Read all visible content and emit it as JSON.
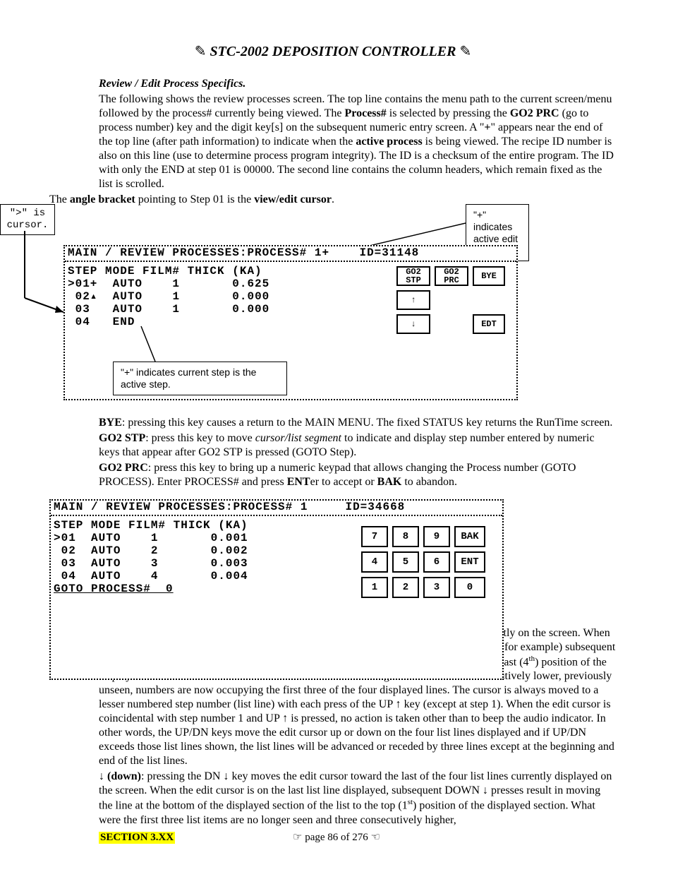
{
  "header": {
    "title": "STC-2002  DEPOSITION CONTROLLER"
  },
  "section_title": "Review / Edit Process Specifics.",
  "intro": {
    "p1a": "The following shows the review processes screen. The top line contains the menu path to the current screen/menu followed by the process# currently being viewed. The ",
    "p1b": "Process#",
    "p1c": " is selected by pressing the ",
    "p1d": "GO2 PRC",
    "p1e": " (go to process number) key and the digit key[s] on  the subsequent numeric entry screen. A \"",
    "p1f": "+",
    "p1g": "\" appears near the end of the top line (after path information) to indicate when the ",
    "p1h": "active process",
    "p1i": " is being viewed. The recipe ID number is also on this line (use to determine process program integrity). The ID is a checksum of the entire program. The ID with only the END at step 01 is 00000. The second line contains the column headers, which remain fixed as the list is scrolled.",
    "p2a": "The ",
    "p2b": "angle bracket",
    "p2c": " pointing to Step 01 is the ",
    "p2d": "view/edit cursor",
    "p2e": "."
  },
  "callouts": {
    "cursor_note_a": "\">\" is",
    "cursor_note_b": "cursor.",
    "plus_note": "\"+\" indicates active edit process.",
    "step_plus_note": "\"+\" indicates current step is the active step."
  },
  "lcd1": {
    "top": "MAIN / REVIEW PROCESSES:PROCESS# 1+    ID=31148",
    "hdr": "STEP MODE FILM# THICK (KA)",
    "rows": [
      ">01+  AUTO    1       0.625",
      " 02▴  AUTO    1       0.000",
      " 03   AUTO    1       0.000",
      " 04   END"
    ],
    "keys": {
      "r1c1": "GO2\nSTP",
      "r1c2": "GO2\nPRC",
      "r1c3": "BYE",
      "r2c1": "↑",
      "r2c2": "",
      "r2c3": "",
      "r3c1": "↓",
      "r3c2": "",
      "r3c3": "EDT"
    }
  },
  "mid_text": {
    "bye_b": "BYE",
    "bye": ": pressing this key causes a return to the MAIN MENU. The fixed STATUS key returns the RunTime screen.",
    "go2stp_b": "GO2 STP",
    "go2stp_a": ": press this key to move ",
    "go2stp_i": "cursor/list segment",
    "go2stp_c": " to indicate and display step number entered by numeric keys that appear after GO2 STP is pressed (GOTO Step).",
    "go2prc_b": "GO2 PRC",
    "go2prc_a": ": press this key to bring up a numeric keypad that allows changing the Process number (GOTO PROCESS). Enter PROCESS# and press ",
    "ent_b": "ENT",
    "go2prc_c": "er to accept or ",
    "bak_b": "BAK",
    "go2prc_d": " to abandon."
  },
  "lcd2": {
    "top": "MAIN / REVIEW PROCESSES:PROCESS# 1     ID=34668",
    "hdr": "STEP MODE FILM# THICK (KA)",
    "rows": [
      ">01  AUTO    1       0.001",
      " 02  AUTO    2       0.002",
      " 03  AUTO    3       0.003",
      " 04  AUTO    4       0.004"
    ],
    "goto": "GOTO PROCESS#  0",
    "num": {
      "k789": [
        "7",
        "8",
        "9",
        "BAK"
      ],
      "k456": [
        "4",
        "5",
        "6",
        "ENT"
      ],
      "k123": [
        "1",
        "2",
        "3",
        "0"
      ]
    }
  },
  "lower_text": {
    "up1": "↑: pressing the UP ↑ key moves the edit cursor toward the first of the four list lines currently on the screen. When the edit cursor is on the first list line displayed (somewhere in the middle of a 20 line list, for example) subsequent UP ↑ presses result in moving the line at the top of the displayed section of the list to the last (4",
    "up1_sup": "th",
    "up1b": ") position of the displayed section. What were the last three list items are no longer seen and three consecutively lower, previously unseen, numbers are now occupying the first three of the four displayed lines.  The cursor is always moved to a lesser numbered step number (list line) with each press of the UP ↑ key (except at step 1). When the edit cursor is coincidental with step number 1 and UP ↑ is pressed, no action is taken other than to beep the audio indicator.  In other words, the UP/DN keys move the edit cursor up or down on the four list lines displayed and if UP/DN exceeds those list lines shown, the list lines will be advanced or receded by three lines except at the beginning and end of the list lines.",
    "dn_b": "↓ (down)",
    "dn1": ": pressing the DN ↓ key moves the edit cursor toward the last of the four list lines currently displayed on the screen.  When the edit cursor is on the last list line displayed, subsequent DOWN ↓ presses result in moving the line at the bottom of the displayed section of the list to the top (1",
    "dn1_sup": "st",
    "dn1b": ") position of the displayed section. What were the first three list items are no longer seen and three consecutively higher,"
  },
  "footer": {
    "section": "SECTION 3.XX",
    "page": "page 86 of 276"
  }
}
